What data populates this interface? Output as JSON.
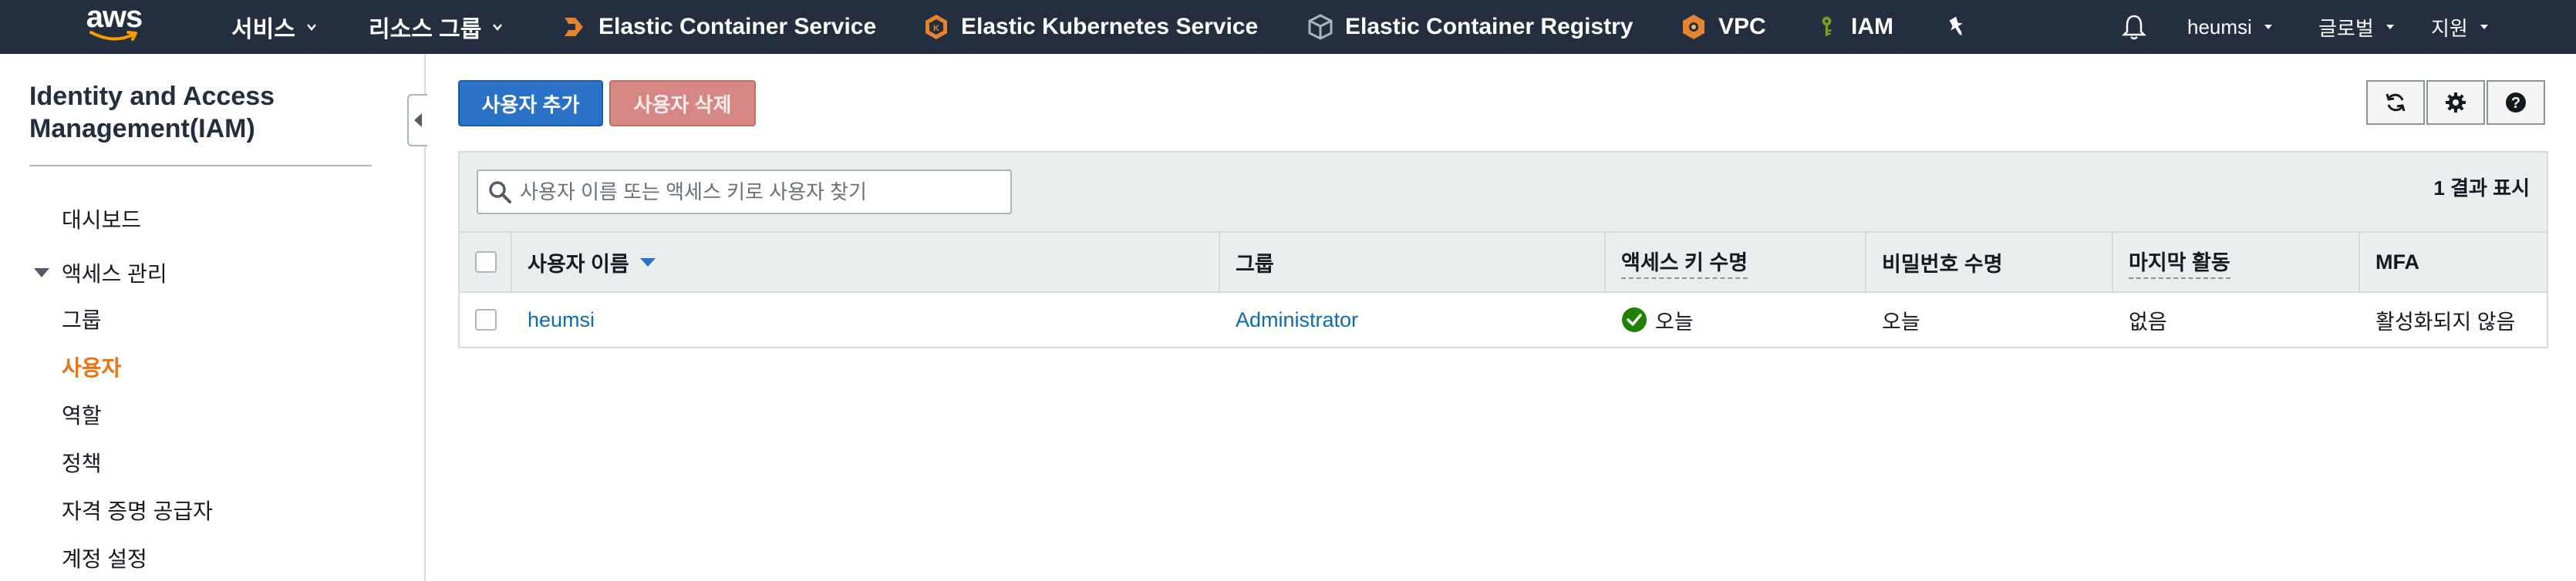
{
  "topnav": {
    "logo_text": "aws",
    "services_label": "서비스",
    "resource_groups_label": "리소스 그룹",
    "pinned": [
      {
        "label": "Elastic Container Service",
        "icon": "ecs-icon",
        "color": "#e7822e"
      },
      {
        "label": "Elastic Kubernetes Service",
        "icon": "eks-icon",
        "color": "#e7822e"
      },
      {
        "label": "Elastic Container Registry",
        "icon": "ecr-icon",
        "color": "#aab7b8"
      },
      {
        "label": "VPC",
        "icon": "vpc-icon",
        "color": "#e7822e"
      },
      {
        "label": "IAM",
        "icon": "iam-key-icon",
        "color": "#7aa116"
      }
    ],
    "account_label": "heumsi",
    "region_label": "글로벌",
    "support_label": "지원"
  },
  "sidebar": {
    "title": "Identity and Access Management(IAM)",
    "dashboard": "대시보드",
    "section_access": "액세스 관리",
    "items": [
      {
        "label": "그룹",
        "active": false
      },
      {
        "label": "사용자",
        "active": true
      },
      {
        "label": "역할",
        "active": false
      },
      {
        "label": "정책",
        "active": false
      },
      {
        "label": "자격 증명 공급자",
        "active": false
      },
      {
        "label": "계정 설정",
        "active": false
      }
    ]
  },
  "main": {
    "add_user_label": "사용자 추가",
    "delete_user_label": "사용자 삭제",
    "search_placeholder": "사용자 이름 또는 액세스 키로 사용자 찾기",
    "result_count": "1 결과 표시",
    "columns": [
      "사용자 이름",
      "그룹",
      "액세스 키 수명",
      "비밀번호 수명",
      "마지막 활동",
      "MFA"
    ],
    "rows": [
      {
        "username": "heumsi",
        "group": "Administrator",
        "access_key_age": "오늘",
        "password_age": "오늘",
        "last_activity": "없음",
        "mfa": "활성화되지 않음"
      }
    ]
  },
  "colors": {
    "nav_bg": "#232f3e",
    "accent_orange": "#ec7211",
    "primary_blue": "#2a72c8",
    "link_blue": "#0b6bb5",
    "success_green": "#1d8102"
  }
}
